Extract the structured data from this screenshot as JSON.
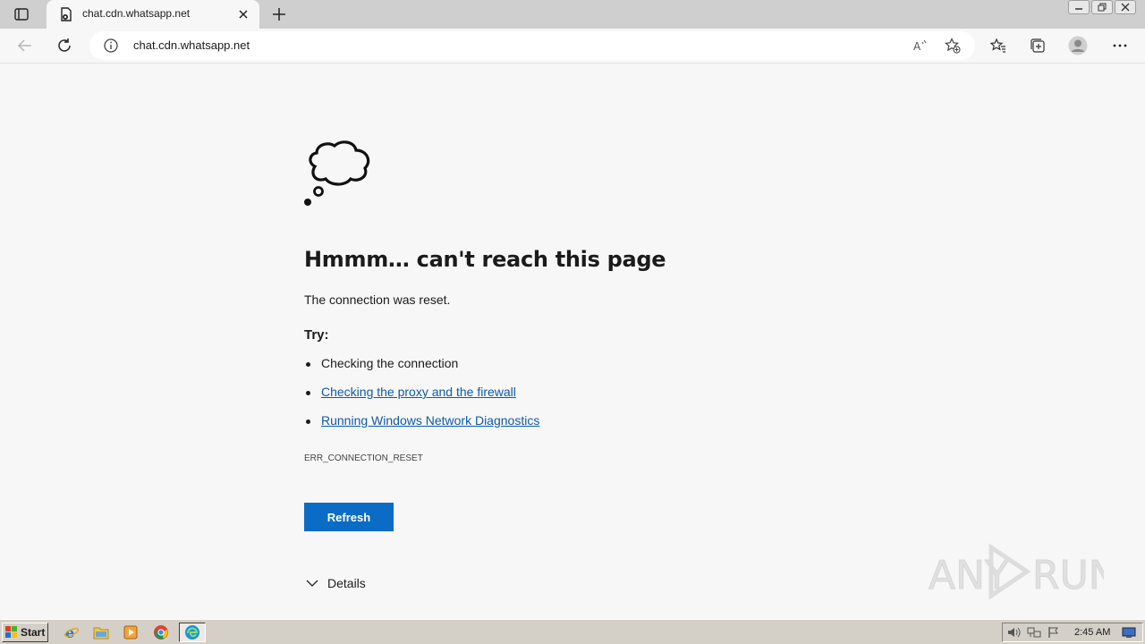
{
  "browser": {
    "tab": {
      "title": "chat.cdn.whatsapp.net"
    },
    "address": {
      "url": "chat.cdn.whatsapp.net"
    }
  },
  "page": {
    "headline": "Hmmm… can't reach this page",
    "subtext": "The connection was reset.",
    "try_label": "Try:",
    "suggestions": [
      {
        "text": "Checking the connection",
        "link": false
      },
      {
        "text": "Checking the proxy and the firewall",
        "link": true
      },
      {
        "text": "Running Windows Network Diagnostics",
        "link": true
      }
    ],
    "error_code": "ERR_CONNECTION_RESET",
    "refresh_label": "Refresh",
    "details_label": "Details"
  },
  "watermark": {
    "text": "ANY RUN"
  },
  "taskbar": {
    "start_label": "Start",
    "apps": [
      "ie-icon",
      "folder-icon",
      "media-player-icon",
      "chrome-icon",
      "edge-icon"
    ],
    "clock": "2:45 AM"
  },
  "colors": {
    "accent": "#0a6cc4",
    "link": "#0f5aa8"
  }
}
